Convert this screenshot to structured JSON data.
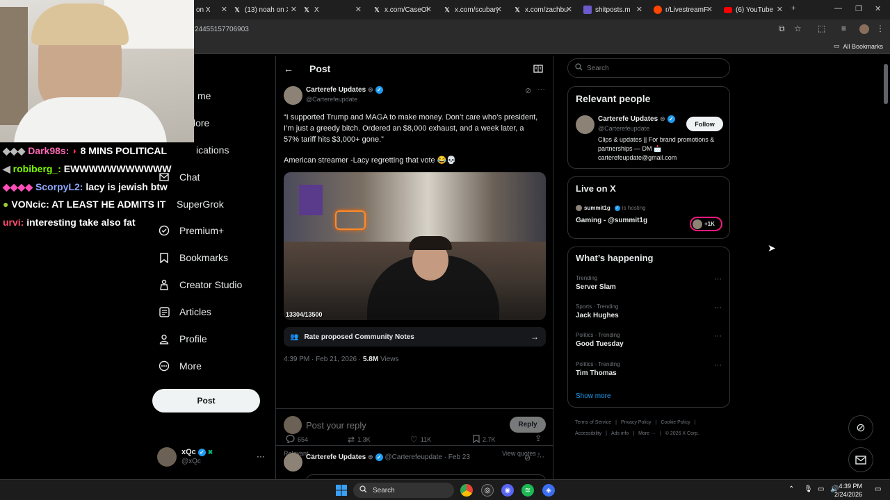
{
  "browser": {
    "tabs": [
      {
        "label": "on X",
        "favicon": "x-icon"
      },
      {
        "label": "(13) noah on X",
        "favicon": "x-icon"
      },
      {
        "label": "X",
        "favicon": "x-icon"
      },
      {
        "label": "x.com/CaseOh",
        "favicon": "x-icon"
      },
      {
        "label": "x.com/scubary",
        "favicon": "x-icon"
      },
      {
        "label": "x.com/zachbu",
        "favicon": "x-icon"
      },
      {
        "label": "shitposts.m",
        "favicon": "generic-icon"
      },
      {
        "label": "r/LivestreamFa",
        "favicon": "reddit-icon"
      },
      {
        "label": "(6) YouTube",
        "favicon": "youtube-icon"
      }
    ],
    "url": "24455157706903",
    "all_bookmarks": "All Bookmarks"
  },
  "nav": {
    "items": [
      {
        "label": "me",
        "icon": "home-icon"
      },
      {
        "label": "lore",
        "icon": "explore-icon"
      },
      {
        "label": "ications",
        "icon": "bell-icon"
      },
      {
        "label": "Chat",
        "icon": "mail-icon"
      },
      {
        "label": "SuperGrok",
        "icon": "grok-icon"
      },
      {
        "label": "Premium+",
        "icon": "verified-icon"
      },
      {
        "label": "Bookmarks",
        "icon": "bookmark-icon"
      },
      {
        "label": "Creator Studio",
        "icon": "creator-icon"
      },
      {
        "label": "Articles",
        "icon": "articles-icon"
      },
      {
        "label": "Profile",
        "icon": "person-icon"
      },
      {
        "label": "More",
        "icon": "more-circle-icon"
      }
    ],
    "post_button": "Post",
    "account": {
      "name": "xQc",
      "handle": "@xQc"
    }
  },
  "post": {
    "header": "Post",
    "author_name": "Carterefe Updates",
    "author_handle": "@Carterefeupdate",
    "text": "“I supported Trump and MAGA to make money. Don’t care who’s president, I’m just a greedy bitch. Ordered an $8,000 exhaust, and a week later, a 57% tariff hits $3,000+ gone.”",
    "text2": "American streamer -Lacy regretting that vote 😂💀",
    "media_counter": "13304/13500",
    "community_notes": "Rate proposed Community Notes",
    "time": "4:39 PM · Feb 21, 2026 ·",
    "views_count": "5.8M",
    "views_label": "Views",
    "replies": "654",
    "reposts": "1.3K",
    "likes": "11K",
    "bookmarks": "2.7K",
    "sort_label": "Relevant",
    "view_quotes": "View quotes",
    "reply_placeholder": "Post your reply",
    "reply_button": "Reply"
  },
  "next_post": {
    "author_name": "Carterefe Updates",
    "author_handle": "@Carterefeupdate",
    "date": "· Feb 23"
  },
  "search": {
    "placeholder": "Search"
  },
  "relevant": {
    "title": "Relevant people",
    "name": "Carterefe Updates",
    "handle": "@Carterefeupdate",
    "follow": "Follow",
    "bio": "Clips & updates || For brand promotions & partnerships — DM 📩 carterefeupdate@gmail.com"
  },
  "live": {
    "title": "Live on X",
    "host": "summit1g",
    "hosting": "is hosting",
    "stream_title": "Gaming - @summit1g",
    "viewers": "+1K"
  },
  "happening": {
    "title": "What’s happening",
    "trends": [
      {
        "category": "Trending",
        "title": "Server Slam"
      },
      {
        "category": "Sports · Trending",
        "title": "Jack Hughes"
      },
      {
        "category": "Politics · Trending",
        "title": "Good Tuesday"
      },
      {
        "category": "Politics · Trending",
        "title": "Tim Thomas"
      }
    ],
    "show_more": "Show more"
  },
  "footer": [
    "Terms of Service",
    "Privacy Policy",
    "Cookie Policy",
    "Accessibility",
    "Ads info",
    "More ···",
    "© 2026 X Corp."
  ],
  "chat": [
    {
      "user": "Dark98s:",
      "message": "8 MINS POLITICAL",
      "color": "#ff69b4"
    },
    {
      "user": "robiberg_:",
      "message": "EWWWWWWWWWWW",
      "color": "#7cfc00"
    },
    {
      "user": "ScorpyL2:",
      "message": "lacy is jewish btw",
      "color": "#8fa8ff"
    },
    {
      "user": "VONcic:",
      "message": "AT LEAST HE ADMITS IT",
      "color": "#ffffff"
    },
    {
      "user": "urvi:",
      "message": "interesting take also fat",
      "color": "#ff4d6d"
    }
  ],
  "taskbar": {
    "search": "Search",
    "time": "4:39 PM",
    "date": "2/24/2026"
  },
  "colors": {
    "accent": "#1d9bf0",
    "background": "#000000",
    "border": "#2f3336",
    "muted": "#71767b"
  }
}
